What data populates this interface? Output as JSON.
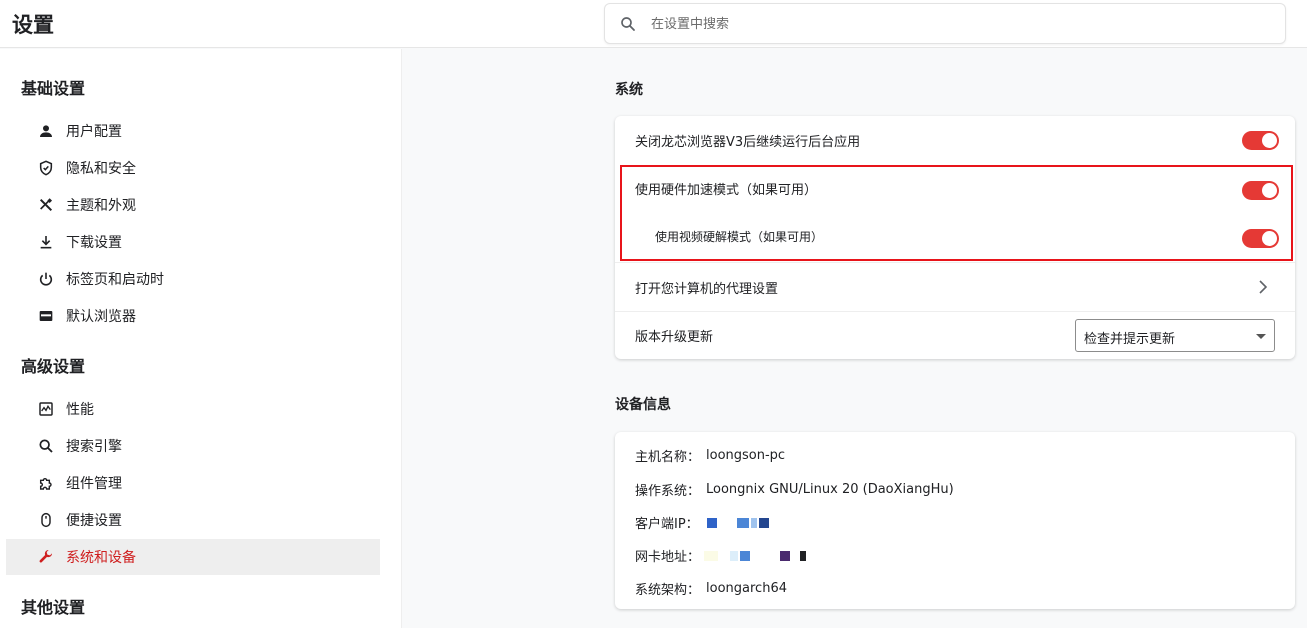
{
  "header": {
    "title": "设置",
    "search_placeholder": "在设置中搜索"
  },
  "sidebar": {
    "sections": [
      {
        "title": "基础设置"
      },
      {
        "title": "高级设置"
      },
      {
        "title": "其他设置"
      }
    ],
    "items": [
      {
        "label": "用户配置",
        "icon": "person-icon"
      },
      {
        "label": "隐私和安全",
        "icon": "shield-icon"
      },
      {
        "label": "主题和外观",
        "icon": "brush-icon"
      },
      {
        "label": "下载设置",
        "icon": "download-icon"
      },
      {
        "label": "标签页和启动时",
        "icon": "power-icon"
      },
      {
        "label": "默认浏览器",
        "icon": "browser-icon"
      },
      {
        "label": "性能",
        "icon": "performance-icon"
      },
      {
        "label": "搜索引擎",
        "icon": "search-icon"
      },
      {
        "label": "组件管理",
        "icon": "puzzle-icon"
      },
      {
        "label": "便捷设置",
        "icon": "mouse-icon"
      },
      {
        "label": "系统和设备",
        "icon": "wrench-icon",
        "active": true
      }
    ]
  },
  "system": {
    "title": "系统",
    "rows": [
      {
        "label": "关闭龙芯浏览器V3后继续运行后台应用",
        "toggle": true
      },
      {
        "label": "使用硬件加速模式（如果可用）",
        "toggle": true
      },
      {
        "label": "使用视频硬解模式（如果可用）",
        "toggle": true
      },
      {
        "label": "打开您计算机的代理设置"
      },
      {
        "label": "版本升级更新",
        "select_value": "检查并提示更新"
      }
    ]
  },
  "device_info": {
    "title": "设备信息",
    "rows": [
      {
        "key": "主机名称：",
        "value": "loongson-pc"
      },
      {
        "key": "操作系统：",
        "value": "Loongnix GNU/Linux 20 (DaoXiangHu)"
      },
      {
        "key": "客户端IP：",
        "value": ""
      },
      {
        "key": "网卡地址：",
        "value": ""
      },
      {
        "key": "系统架构：",
        "value": "loongarch64"
      }
    ]
  },
  "colors": {
    "accent": "#e53935",
    "highlight_border": "#e8141a",
    "active_text": "#cf1f1f"
  }
}
